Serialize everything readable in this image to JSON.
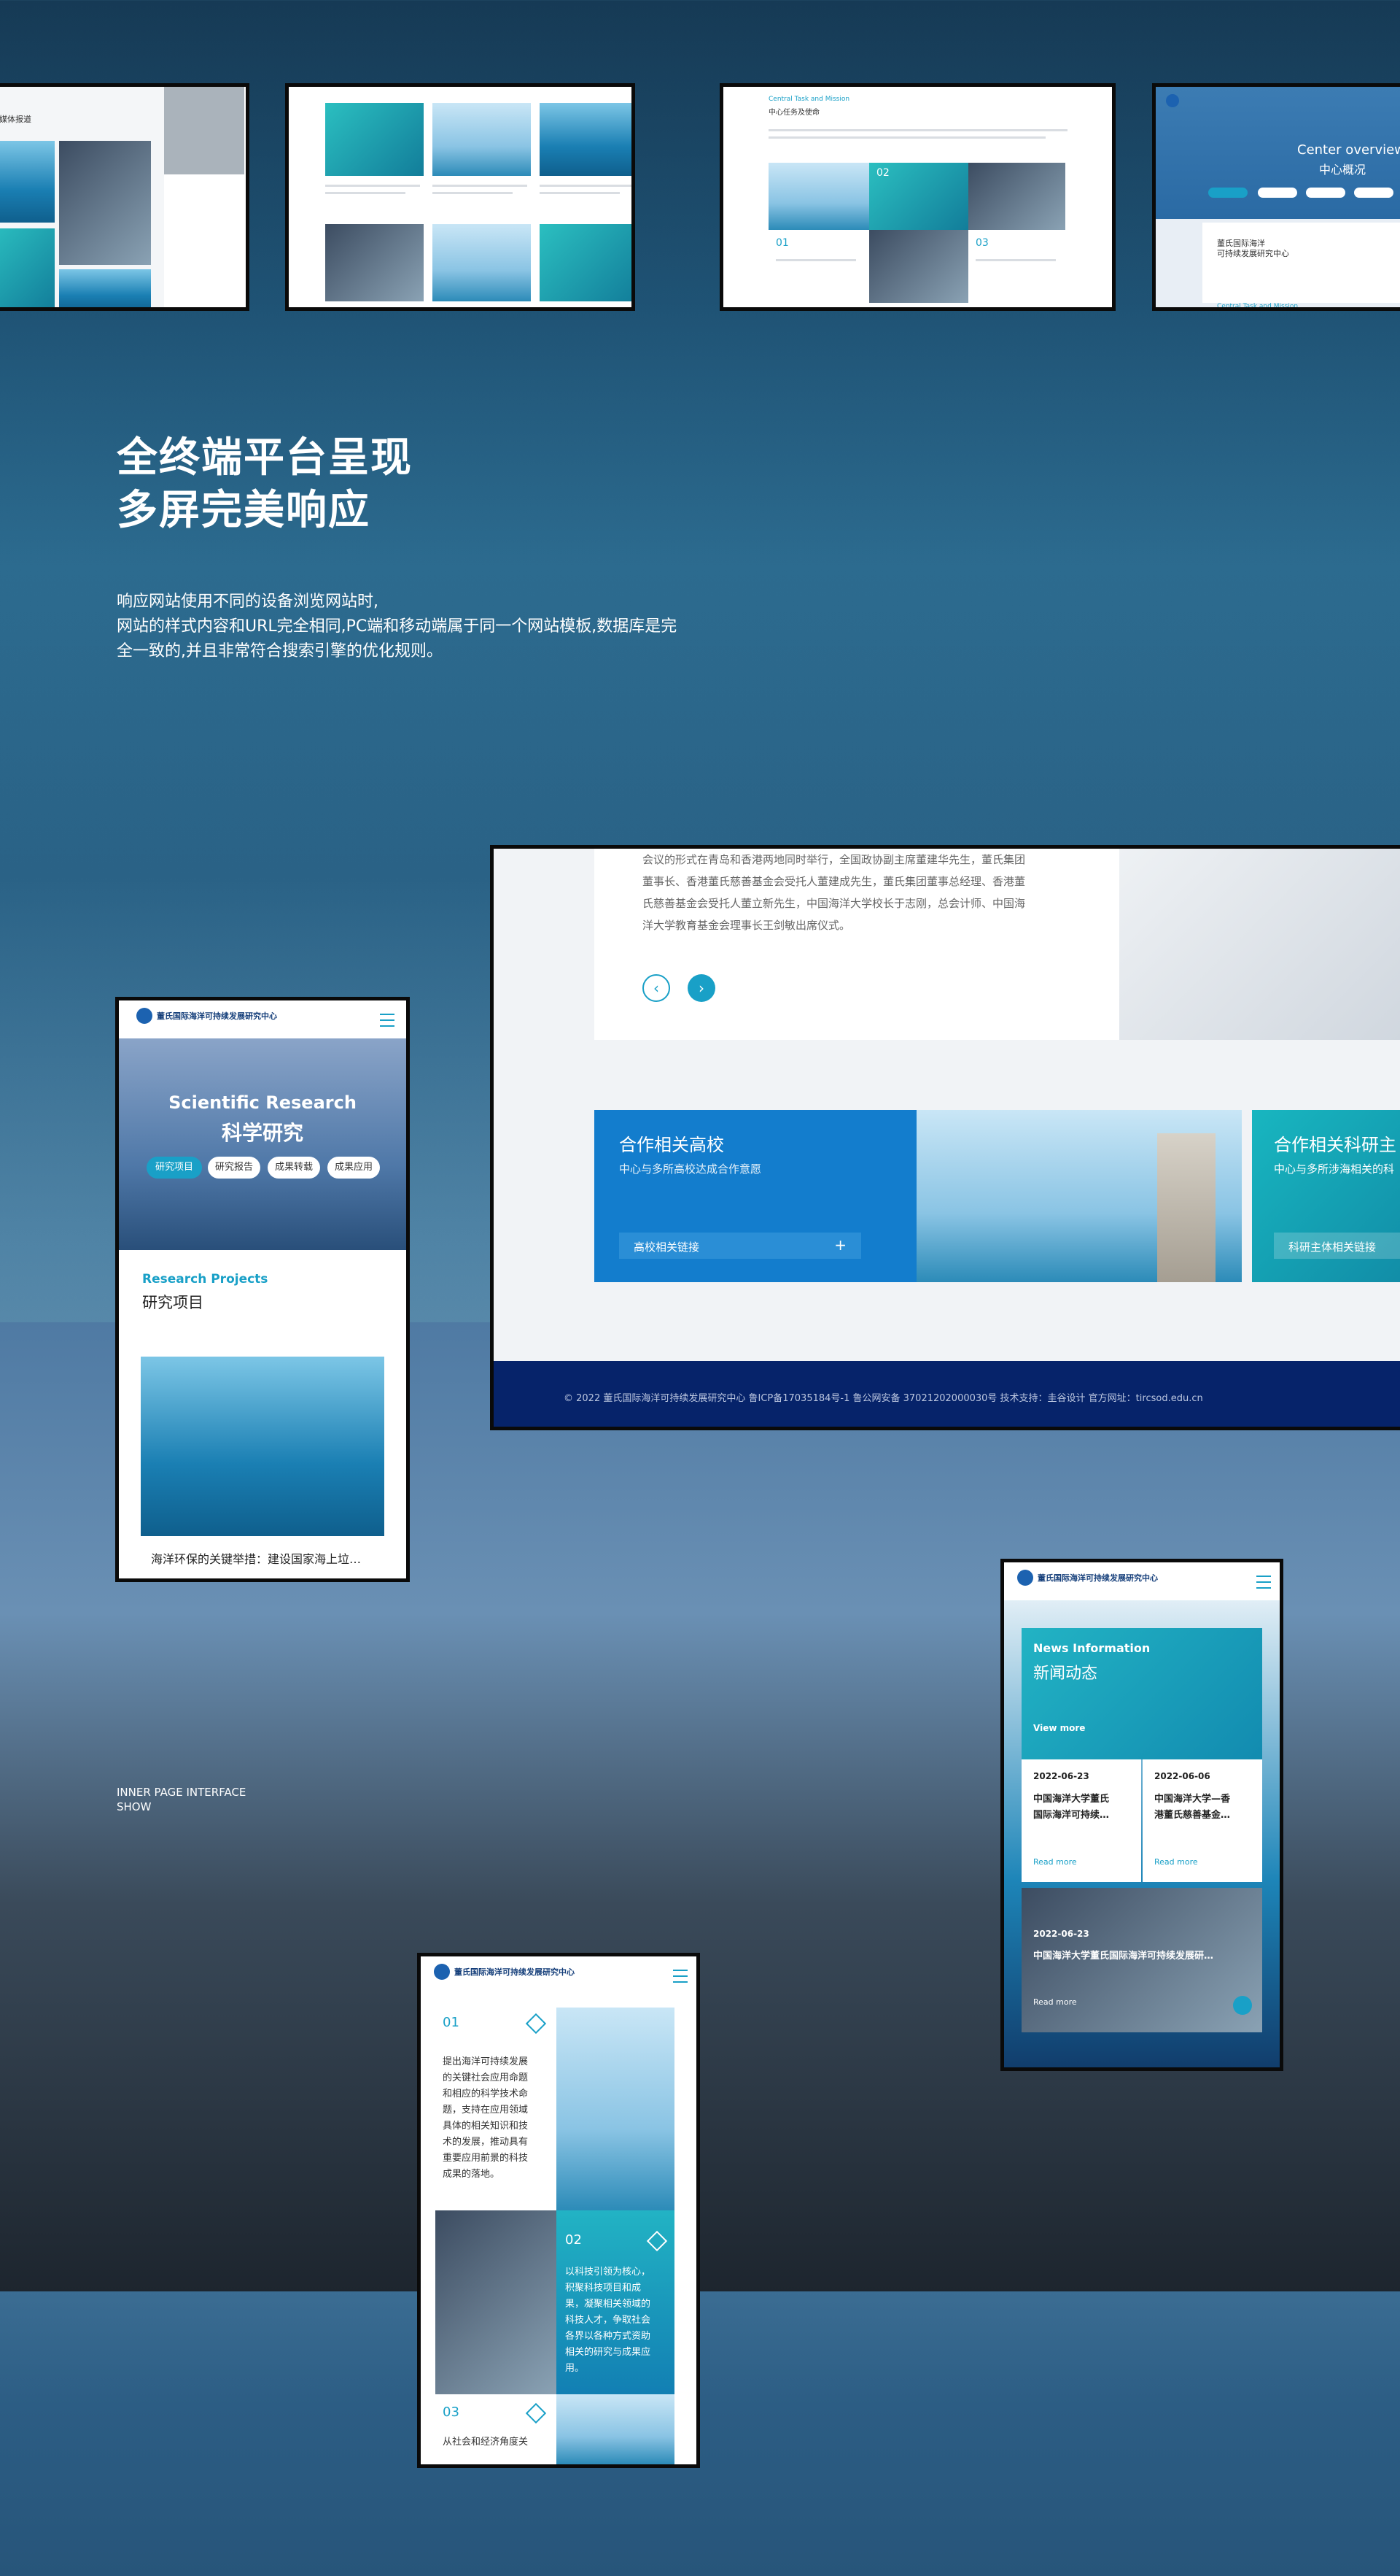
{
  "showcase": {
    "heading_line1": "全终端平台呈现",
    "heading_line2": "多屏完美响应",
    "desc_line1": "响应网站使用不同的设备浏览网站时,",
    "desc_line2": "网站的样式内容和URL完全相同,PC端和移动端属于同一个网站模板,数据库是完",
    "desc_line3": "全一致的,并且非常符合搜索引擎的优化规则。",
    "inner_label_line1": "INNER PAGE INTERFACE",
    "inner_label_line2": "SHOW"
  },
  "thumb1": {
    "label": "媒体报道"
  },
  "thumb3": {
    "en": "Central Task and Mission",
    "zh": "中心任务及使命",
    "n1": "01",
    "n2": "02",
    "n3": "03"
  },
  "thumb4": {
    "en": "Center overview",
    "zh": "中心概况",
    "card_line1": "董氏国际海洋",
    "card_line2": "可持续发展研究中心",
    "footer_en": "Central Task and Mission"
  },
  "pc_page": {
    "article_line1": "会议的形式在青岛和香港两地同时举行，全国政协副主席董建华先生，董氏集团",
    "article_line2": "董事长、香港董氏慈善基金会受托人董建成先生，董氏集团董事总经理、香港董",
    "article_line3": "氏慈善基金会受托人董立新先生，中国海洋大学校长于志刚，总会计师、中国海",
    "article_line4": "洋大学教育基金会理事长王剑敏出席仪式。",
    "prev_arrow": "‹",
    "next_arrow": "›",
    "card1_title": "合作相关高校",
    "card1_sub": "中心与多所高校达成合作意愿",
    "card1_link": "高校相关链接",
    "card1_plus": "+",
    "card2_title": "合作相关科研主",
    "card2_sub": "中心与多所涉海相关的科",
    "card2_link": "科研主体相关链接",
    "footer": "© 2022 董氏国际海洋可持续发展研究中心  鲁ICP备17035184号-1  鲁公网安备 37021202000030号  技术支持：圭谷设计   官方网址：tircsod.edu.cn"
  },
  "mobile1": {
    "logo_zh": "董氏国际海洋可持续发展研究中心",
    "hero_en": "Scientific Research",
    "hero_zh": "科学研究",
    "tabs": [
      "研究项目",
      "研究报告",
      "成果转载",
      "成果应用"
    ],
    "section_en": "Research Projects",
    "section_zh": "研究项目",
    "item_title": "海洋环保的关键举措：建设国家海上垃…"
  },
  "mobile2": {
    "logo_zh": "董氏国际海洋可持续发展研究中心",
    "news_en": "News Information",
    "news_zh": "新闻动态",
    "view_more": "View more",
    "date1": "2022-06-23",
    "title1_l1": "中国海洋大学董氏",
    "title1_l2": "国际海洋可持续…",
    "date2": "2022-06-06",
    "title2_l1": "中国海洋大学—香",
    "title2_l2": "港董氏慈善基金…",
    "read_more": "Read more",
    "date3": "2022-06-23",
    "title3": "中国海洋大学董氏国际海洋可持续发展研…",
    "read_more2": "Read more"
  },
  "mobile3": {
    "logo_zh": "董氏国际海洋可持续发展研究中心",
    "n1": "01",
    "text1": [
      "提出海洋可持续发展",
      "的关键社会应用命题",
      "和相应的科学技术命",
      "题，支持在应用领域",
      "具体的相关知识和技",
      "术的发展，推动具有",
      "重要应用前景的科技",
      "成果的落地。"
    ],
    "n2": "02",
    "text2": [
      "以科技引领为核心，",
      "积聚科技项目和成",
      "果，凝聚相关领域的",
      "科技人才，争取社会",
      "各界以各种方式资助",
      "相关的研究与成果应",
      "用。"
    ],
    "n3": "03",
    "text3": "从社会和经济角度关"
  }
}
